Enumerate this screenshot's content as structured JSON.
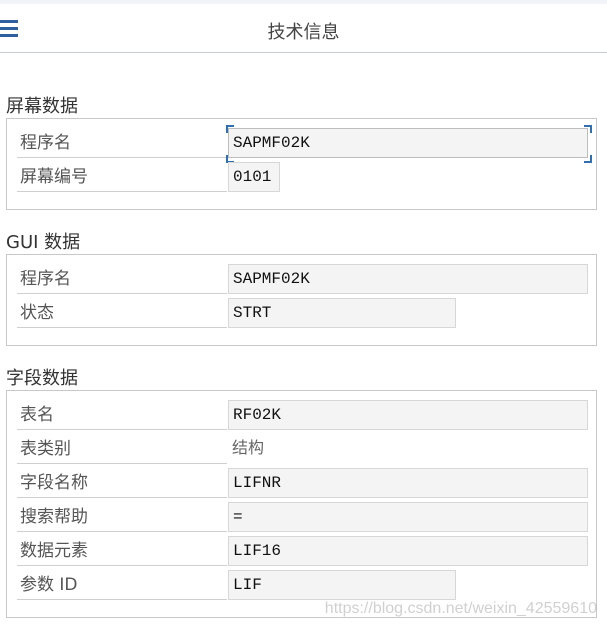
{
  "header": {
    "title": "技术信息"
  },
  "screen_data": {
    "title": "屏幕数据",
    "rows": [
      {
        "label": "程序名",
        "value": "SAPMF02K"
      },
      {
        "label": "屏幕编号",
        "value": "0101"
      }
    ]
  },
  "gui_data": {
    "title": "GUI 数据",
    "rows": [
      {
        "label": "程序名",
        "value": "SAPMF02K"
      },
      {
        "label": "状态",
        "value": "STRT"
      }
    ]
  },
  "field_data": {
    "title": "字段数据",
    "rows": [
      {
        "label": "表名",
        "value": "RF02K"
      },
      {
        "label": "表类别",
        "value": "结构"
      },
      {
        "label": "字段名称",
        "value": "LIFNR"
      },
      {
        "label": "搜索帮助",
        "value": "="
      },
      {
        "label": "数据元素",
        "value": "LIF16"
      },
      {
        "label": "参数 ID",
        "value": "LIF"
      }
    ]
  },
  "watermark": "https://blog.csdn.net/weixin_42559610",
  "colors": {
    "accent": "#2f6fb3",
    "field_bg": "#f4f4f4",
    "border": "#c8c8c8"
  },
  "icons": {
    "menu": "hamburger-menu-icon"
  }
}
